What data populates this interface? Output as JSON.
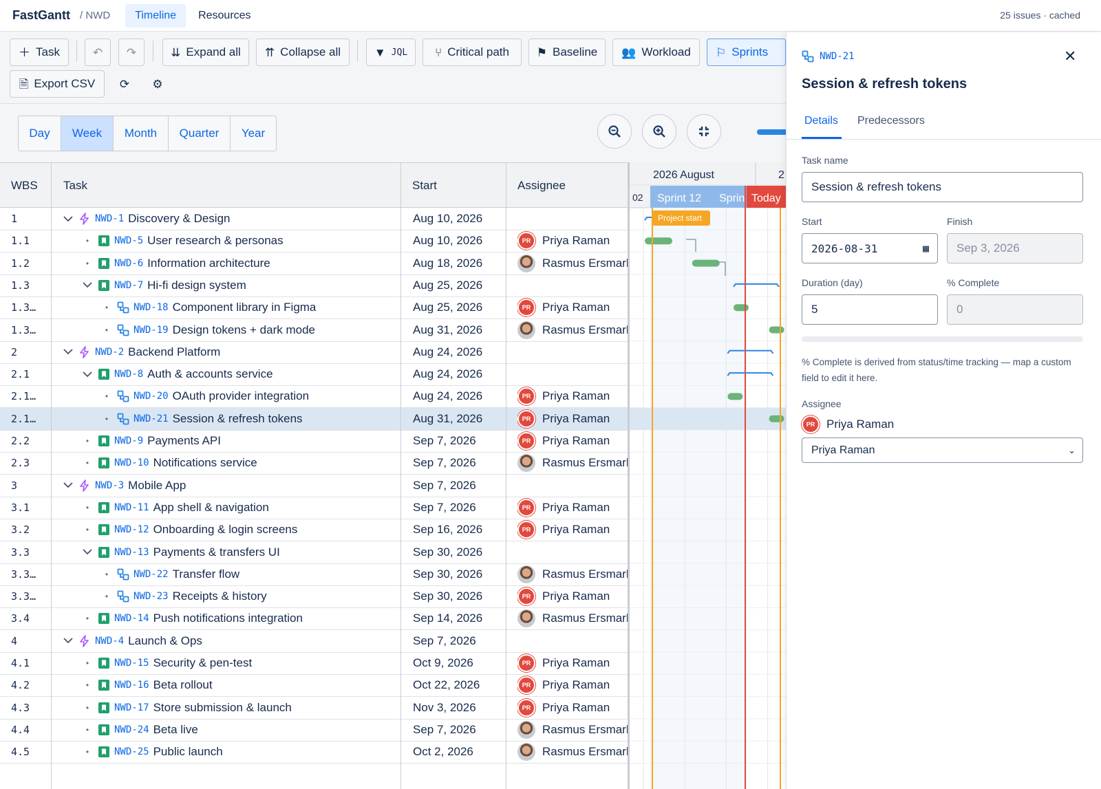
{
  "app": {
    "name": "FastGantt",
    "project": "/ NWD",
    "status": "25 issues · cached"
  },
  "nav": {
    "timeline": "Timeline",
    "resources": "Resources"
  },
  "toolbar": {
    "task": "Task",
    "expand_all": "Expand all",
    "collapse_all": "Collapse all",
    "jql": "JQL",
    "critical_path": "Critical path",
    "baseline": "Baseline",
    "workload": "Workload",
    "sprints": "Sprints",
    "export_csv": "Export CSV"
  },
  "scales": [
    "Day",
    "Week",
    "Month",
    "Quarter",
    "Year"
  ],
  "active_scale": "Week",
  "columns": {
    "wbs": "WBS",
    "task": "Task",
    "start": "Start",
    "assignee": "Assignee"
  },
  "timeline": {
    "month_label": "2026 August",
    "month_label_2": "2",
    "week_label": "02",
    "sprint_1": "Sprint 12",
    "sprint_2": "Sprin",
    "today": "Today",
    "project_start": "Project start"
  },
  "rows": [
    {
      "wbs": "1",
      "level": 0,
      "toggle": "expanded",
      "type": "epic",
      "key": "NWD-1",
      "name": "Discovery & Design",
      "start": "Aug 10, 2026",
      "assignee": "",
      "avatar": ""
    },
    {
      "wbs": "1.1",
      "level": 1,
      "toggle": "leaf",
      "type": "story",
      "key": "NWD-5",
      "name": "User research & personas",
      "start": "Aug 10, 2026",
      "assignee": "Priya Raman",
      "avatar": "PR"
    },
    {
      "wbs": "1.2",
      "level": 1,
      "toggle": "leaf",
      "type": "story",
      "key": "NWD-6",
      "name": "Information architecture",
      "start": "Aug 18, 2026",
      "assignee": "Rasmus Ersmarl",
      "avatar": "RE"
    },
    {
      "wbs": "1.3",
      "level": 1,
      "toggle": "expanded",
      "type": "story",
      "key": "NWD-7",
      "name": "Hi-fi design system",
      "start": "Aug 25, 2026",
      "assignee": "",
      "avatar": ""
    },
    {
      "wbs": "1.3…",
      "level": 2,
      "toggle": "leaf",
      "type": "subtask",
      "key": "NWD-18",
      "name": "Component library in Figma",
      "start": "Aug 25, 2026",
      "assignee": "Priya Raman",
      "avatar": "PR"
    },
    {
      "wbs": "1.3…",
      "level": 2,
      "toggle": "leaf",
      "type": "subtask",
      "key": "NWD-19",
      "name": "Design tokens + dark mode",
      "start": "Aug 31, 2026",
      "assignee": "Rasmus Ersmarl",
      "avatar": "RE"
    },
    {
      "wbs": "2",
      "level": 0,
      "toggle": "expanded",
      "type": "epic",
      "key": "NWD-2",
      "name": "Backend Platform",
      "start": "Aug 24, 2026",
      "assignee": "",
      "avatar": ""
    },
    {
      "wbs": "2.1",
      "level": 1,
      "toggle": "expanded",
      "type": "story",
      "key": "NWD-8",
      "name": "Auth & accounts service",
      "start": "Aug 24, 2026",
      "assignee": "",
      "avatar": ""
    },
    {
      "wbs": "2.1…",
      "level": 2,
      "toggle": "leaf",
      "type": "subtask",
      "key": "NWD-20",
      "name": "OAuth provider integration",
      "start": "Aug 24, 2026",
      "assignee": "Priya Raman",
      "avatar": "PR"
    },
    {
      "wbs": "2.1…",
      "level": 2,
      "toggle": "leaf",
      "type": "subtask",
      "key": "NWD-21",
      "name": "Session & refresh tokens",
      "start": "Aug 31, 2026",
      "assignee": "Priya Raman",
      "avatar": "PR",
      "selected": true
    },
    {
      "wbs": "2.2",
      "level": 1,
      "toggle": "leaf",
      "type": "story",
      "key": "NWD-9",
      "name": "Payments API",
      "start": "Sep 7, 2026",
      "assignee": "Priya Raman",
      "avatar": "PR"
    },
    {
      "wbs": "2.3",
      "level": 1,
      "toggle": "leaf",
      "type": "story",
      "key": "NWD-10",
      "name": "Notifications service",
      "start": "Sep 7, 2026",
      "assignee": "Rasmus Ersmarl",
      "avatar": "RE"
    },
    {
      "wbs": "3",
      "level": 0,
      "toggle": "expanded",
      "type": "epic",
      "key": "NWD-3",
      "name": "Mobile App",
      "start": "Sep 7, 2026",
      "assignee": "",
      "avatar": ""
    },
    {
      "wbs": "3.1",
      "level": 1,
      "toggle": "leaf",
      "type": "story",
      "key": "NWD-11",
      "name": "App shell & navigation",
      "start": "Sep 7, 2026",
      "assignee": "Priya Raman",
      "avatar": "PR"
    },
    {
      "wbs": "3.2",
      "level": 1,
      "toggle": "leaf",
      "type": "story",
      "key": "NWD-12",
      "name": "Onboarding & login screens",
      "start": "Sep 16, 2026",
      "assignee": "Priya Raman",
      "avatar": "PR"
    },
    {
      "wbs": "3.3",
      "level": 1,
      "toggle": "expanded",
      "type": "story",
      "key": "NWD-13",
      "name": "Payments & transfers UI",
      "start": "Sep 30, 2026",
      "assignee": "",
      "avatar": ""
    },
    {
      "wbs": "3.3…",
      "level": 2,
      "toggle": "leaf",
      "type": "subtask",
      "key": "NWD-22",
      "name": "Transfer flow",
      "start": "Sep 30, 2026",
      "assignee": "Rasmus Ersmarl",
      "avatar": "RE"
    },
    {
      "wbs": "3.3…",
      "level": 2,
      "toggle": "leaf",
      "type": "subtask",
      "key": "NWD-23",
      "name": "Receipts & history",
      "start": "Sep 30, 2026",
      "assignee": "Priya Raman",
      "avatar": "PR"
    },
    {
      "wbs": "3.4",
      "level": 1,
      "toggle": "leaf",
      "type": "story",
      "key": "NWD-14",
      "name": "Push notifications integration",
      "start": "Sep 14, 2026",
      "assignee": "Rasmus Ersmarl",
      "avatar": "RE"
    },
    {
      "wbs": "4",
      "level": 0,
      "toggle": "expanded",
      "type": "epic",
      "key": "NWD-4",
      "name": "Launch & Ops",
      "start": "Sep 7, 2026",
      "assignee": "",
      "avatar": ""
    },
    {
      "wbs": "4.1",
      "level": 1,
      "toggle": "leaf",
      "type": "story",
      "key": "NWD-15",
      "name": "Security & pen-test",
      "start": "Oct 9, 2026",
      "assignee": "Priya Raman",
      "avatar": "PR"
    },
    {
      "wbs": "4.2",
      "level": 1,
      "toggle": "leaf",
      "type": "story",
      "key": "NWD-16",
      "name": "Beta rollout",
      "start": "Oct 22, 2026",
      "assignee": "Priya Raman",
      "avatar": "PR"
    },
    {
      "wbs": "4.3",
      "level": 1,
      "toggle": "leaf",
      "type": "story",
      "key": "NWD-17",
      "name": "Store submission & launch",
      "start": "Nov 3, 2026",
      "assignee": "Priya Raman",
      "avatar": "PR"
    },
    {
      "wbs": "4.4",
      "level": 1,
      "toggle": "leaf",
      "type": "story",
      "key": "NWD-24",
      "name": "Beta live",
      "start": "Sep 7, 2026",
      "assignee": "Rasmus Ersmarl",
      "avatar": "RE"
    },
    {
      "wbs": "4.5",
      "level": 1,
      "toggle": "leaf",
      "type": "story",
      "key": "NWD-25",
      "name": "Public launch",
      "start": "Oct 2, 2026",
      "assignee": "Rasmus Ersmarl",
      "avatar": "RE"
    }
  ],
  "panel": {
    "key": "NWD-21",
    "title": "Session & refresh tokens",
    "tab_details": "Details",
    "tab_predecessors": "Predecessors",
    "task_name_label": "Task name",
    "task_name_value": "Session & refresh tokens",
    "start_label": "Start",
    "start_value": "2026-08-31",
    "finish_label": "Finish",
    "finish_value": "Sep 3, 2026",
    "duration_label": "Duration (day)",
    "duration_value": "5",
    "complete_label": "% Complete",
    "complete_value": "0",
    "complete_fraction": 0,
    "hint": "% Complete is derived from status/time tracking — map a custom field to edit it here.",
    "assignee_label": "Assignee",
    "assignee_name": "Priya Raman",
    "assignee_initials": "PR",
    "assignee_select": "Priya Raman"
  },
  "colors": {
    "accent": "#0c66e4",
    "epic": "#a855f7",
    "story": "#22a06b",
    "subtask": "#2b85e4",
    "bar": "#6bb37a",
    "today_line": "#e2483d",
    "project_start": "#f5a623"
  }
}
